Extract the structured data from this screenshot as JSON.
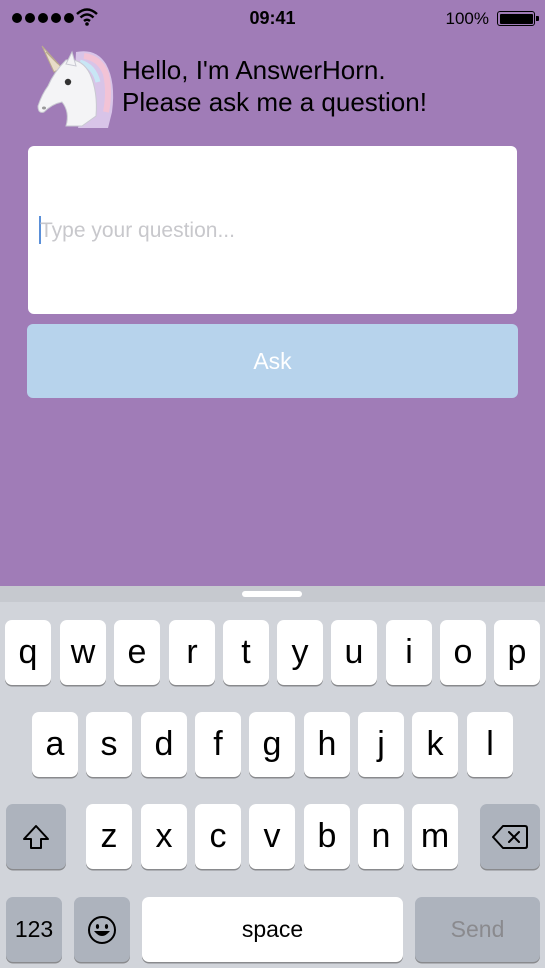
{
  "status_bar": {
    "time": "09:41",
    "battery": "100%"
  },
  "header": {
    "line1": "Hello, I'm AnswerHorn.",
    "line2": "Please ask me a question!",
    "avatar_icon": "unicorn-icon"
  },
  "question": {
    "placeholder": "Type your question...",
    "value": ""
  },
  "ask_button": {
    "label": "Ask"
  },
  "keyboard": {
    "row1": [
      "q",
      "w",
      "e",
      "r",
      "t",
      "y",
      "u",
      "i",
      "o",
      "p"
    ],
    "row2": [
      "a",
      "s",
      "d",
      "f",
      "g",
      "h",
      "j",
      "k",
      "l"
    ],
    "row3": [
      "z",
      "x",
      "c",
      "v",
      "b",
      "n",
      "m"
    ],
    "shift_icon": "shift-icon",
    "delete_icon": "delete-icon",
    "numbers_label": "123",
    "emoji_icon": "emoji-icon",
    "space_label": "space",
    "send_label": "Send"
  },
  "colors": {
    "background": "#a07cb7",
    "ask_button": "#b7d3ec",
    "keyboard": "#d1d4da"
  }
}
